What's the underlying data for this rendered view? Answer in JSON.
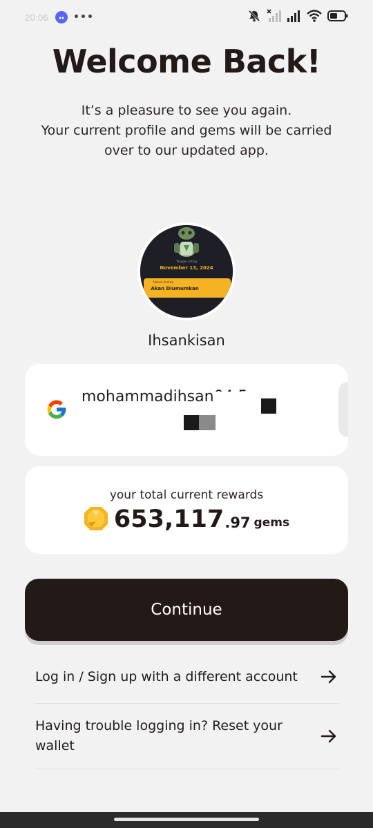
{
  "status_bar": {
    "time": "20:06",
    "more": "•••"
  },
  "header": {
    "title": "Welcome Back!",
    "subtitle_lines": [
      "It’s a pleasure to see you again.",
      "Your current profile and gems will be carried",
      "over to our updated app."
    ]
  },
  "profile": {
    "username": "Ihsankisan",
    "avatar_texts": {
      "listing_label": "Tanggal Listing",
      "listing_date": "November 13, 2024",
      "airdrop_label": "Alokasi Airdrop",
      "airdrop_status": "Akan Diumumkan"
    }
  },
  "account": {
    "provider_icon": "google-icon",
    "email": "mohammadihsan04 5"
  },
  "rewards": {
    "label": "your total current rewards",
    "amount_int": "653,117",
    "amount_dec": ".97",
    "unit": "gems",
    "gem_icon": "gem-icon"
  },
  "actions": {
    "continue_label": "Continue",
    "links": [
      {
        "label": "Log in / Sign up with a different account",
        "icon": "arrow-right-icon"
      },
      {
        "label": "Having trouble logging in? Reset your wallet",
        "icon": "arrow-right-icon"
      }
    ]
  },
  "colors": {
    "background": "#f2f2f2",
    "primary_dark": "#231a18",
    "card": "#ffffff",
    "gem": "#f5b323"
  }
}
